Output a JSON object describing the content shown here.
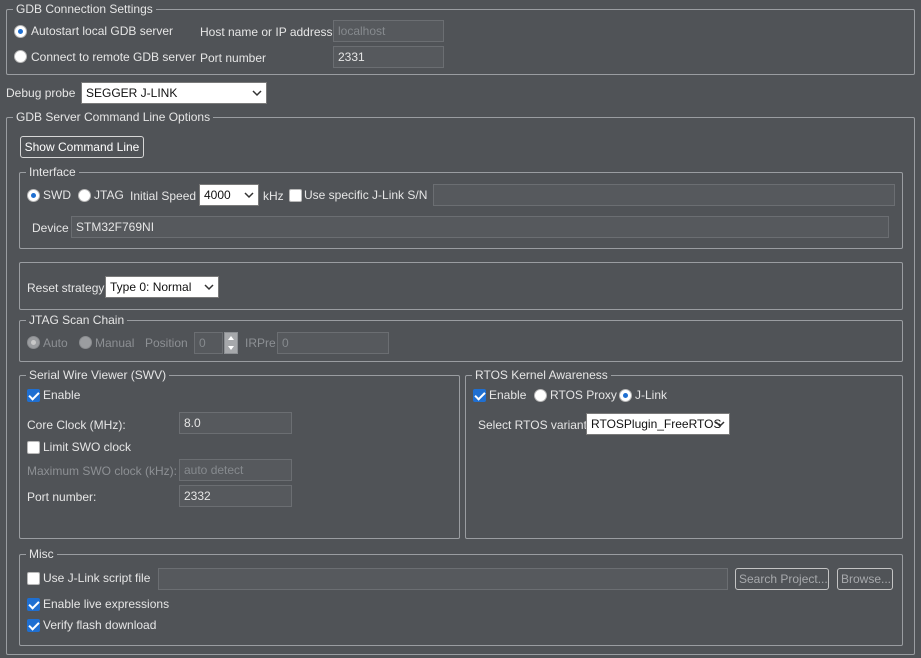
{
  "gdb_connection": {
    "title": "GDB Connection Settings",
    "autostart_label": "Autostart local GDB server",
    "remote_label": "Connect to remote GDB server",
    "host_label": "Host name or IP address",
    "host_value": "localhost",
    "port_label": "Port number",
    "port_value": "2331"
  },
  "debug_probe": {
    "label": "Debug probe",
    "value": "SEGGER J-LINK"
  },
  "gdb_server": {
    "title": "GDB Server Command Line Options",
    "show_cmd_label": "Show Command Line"
  },
  "interface": {
    "title": "Interface",
    "swd_label": "SWD",
    "jtag_label": "JTAG",
    "speed_label": "Initial Speed",
    "speed_value": "4000",
    "speed_unit": "kHz",
    "specific_sn_label": "Use specific J-Link S/N",
    "sn_value": "",
    "device_label": "Device",
    "device_value": "STM32F769NI"
  },
  "reset": {
    "label": "Reset strategy",
    "value": "Type 0: Normal"
  },
  "jtag_scan": {
    "title": "JTAG Scan Chain",
    "auto_label": "Auto",
    "manual_label": "Manual",
    "position_label": "Position",
    "position_value": "0",
    "irpre_label": "IRPre",
    "irpre_value": "0"
  },
  "swv": {
    "title": "Serial Wire Viewer (SWV)",
    "enable_label": "Enable",
    "core_clock_label": "Core Clock (MHz):",
    "core_clock_value": "8.0",
    "limit_swo_label": "Limit SWO clock",
    "max_swo_label": "Maximum SWO clock (kHz):",
    "max_swo_value": "auto detect",
    "port_label": "Port number:",
    "port_value": "2332"
  },
  "rtos": {
    "title": "RTOS Kernel Awareness",
    "enable_label": "Enable",
    "proxy_label": "RTOS Proxy",
    "jlink_label": "J-Link",
    "variant_label": "Select RTOS variant:",
    "variant_value": "RTOSPlugin_FreeRTOS"
  },
  "misc": {
    "title": "Misc",
    "script_label": "Use J-Link script file",
    "script_value": "",
    "search_label": "Search Project...",
    "browse_label": "Browse...",
    "live_expr_label": "Enable live expressions",
    "verify_label": "Verify flash download"
  },
  "colors": {
    "background": "#505357",
    "accent": "#1f6fd1",
    "text": "#e6e6e6"
  }
}
